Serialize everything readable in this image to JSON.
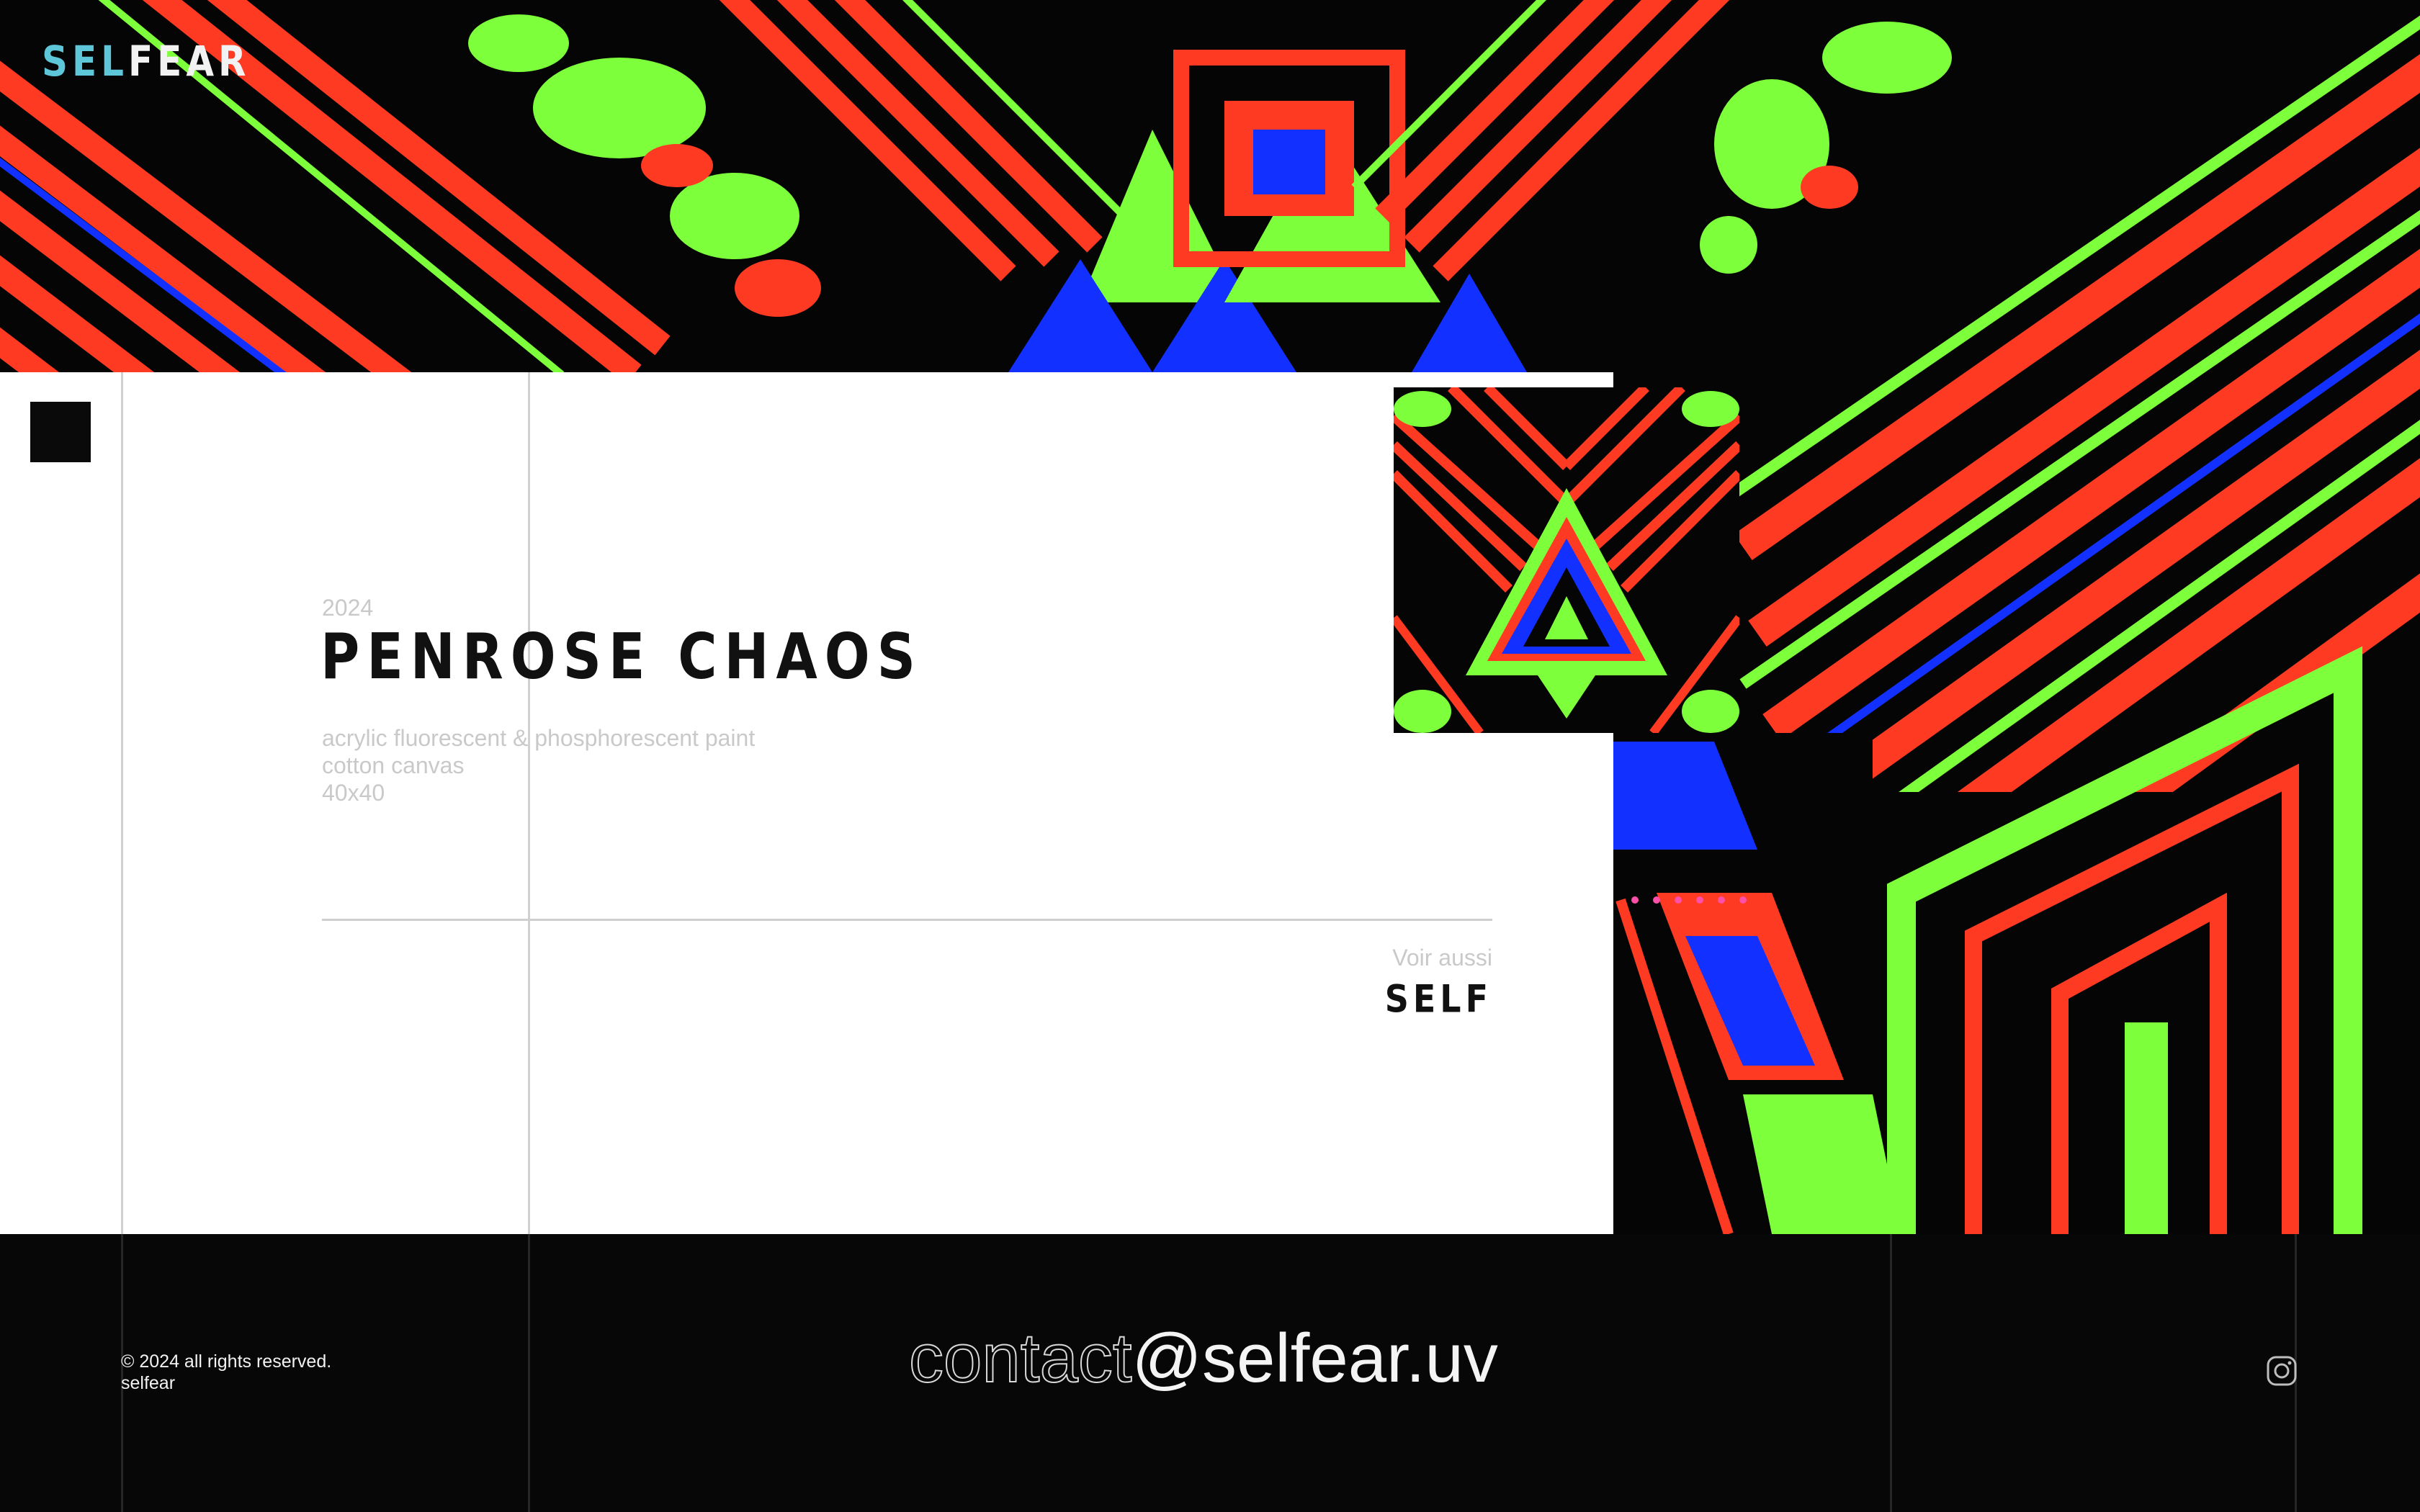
{
  "brand": {
    "logo_part1": "SEL",
    "logo_part2": "FEAR"
  },
  "artwork": {
    "year": "2024",
    "title": "PENROSE CHAOS",
    "specs": [
      "acrylic fluorescent & phosphorescent paint",
      "cotton canvas",
      "40x40"
    ]
  },
  "see_also": {
    "label": "Voir aussi",
    "link": "SELF"
  },
  "footer": {
    "copyright": "© 2024 all rights reserved.",
    "name": "selfear",
    "email_part1": "contact",
    "email_part2": "@selfear.uv"
  },
  "icons": {
    "menu": "menu-icon",
    "social": "instagram-icon"
  },
  "colors": {
    "red": "#ff3a22",
    "green": "#7dff3b",
    "blue": "#1230ff",
    "logo_accent": "#5dc6d8"
  }
}
